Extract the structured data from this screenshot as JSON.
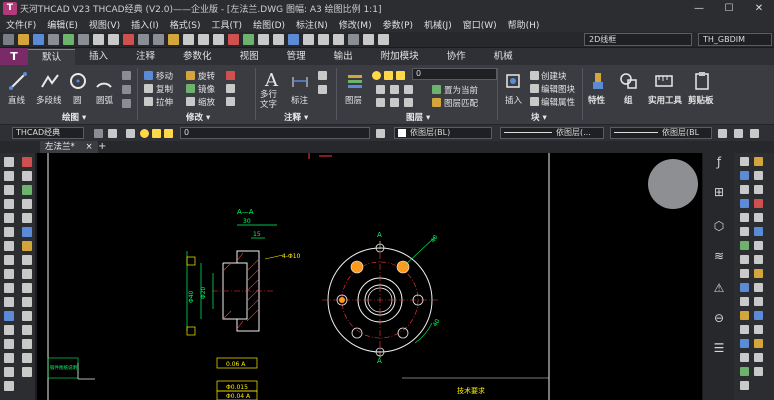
{
  "window": {
    "title": "天河THCAD V23 THCAD经典 (V2.0)——企业版 - [左法兰.DWG 图幅: A3 绘图比例 1:1]",
    "logo": "T",
    "controls": [
      "—",
      "☐",
      "✕"
    ]
  },
  "menu": [
    "文件(F)",
    "编辑(E)",
    "视图(V)",
    "插入(I)",
    "格式(S)",
    "工具(T)",
    "绘图(D)",
    "标注(N)",
    "修改(M)",
    "参数(P)",
    "机械(J)",
    "窗口(W)",
    "帮助(H)"
  ],
  "quick_access": {
    "view_select": "2D线框",
    "dimstyle_select": "TH_GBDIM"
  },
  "ribbon_tabs": {
    "app_button": "T",
    "tabs": [
      "默认",
      "插入",
      "注释",
      "参数化",
      "视图",
      "管理",
      "输出",
      "附加模块",
      "协作",
      "机械"
    ],
    "active_index": 0
  },
  "ribbon": {
    "draw": {
      "line": "直线",
      "polyline": "多段线",
      "circle": "圆",
      "arc": "圆弧",
      "title": "绘图 ▾"
    },
    "modify": {
      "move": "移动",
      "rotate": "旋转",
      "copy": "复制",
      "mirror": "镜像",
      "stretch": "拉伸",
      "scale": "缩放",
      "title": "修改 ▾"
    },
    "annotation": {
      "text": "多行文字",
      "dimension": "标注",
      "title": "注释 ▾"
    },
    "layers": {
      "layer_props": "图层",
      "current_layer": "0",
      "make_current": "置为当前",
      "match_layer": "图层匹配",
      "title": "图层 ▾"
    },
    "block": {
      "insert": "插入",
      "create": "创建块",
      "edit": "编辑图块",
      "edit_attr": "编辑属性",
      "title": "块 ▾"
    },
    "properties": {
      "label": "特性"
    },
    "groups": {
      "label": "组"
    },
    "utilities": {
      "label": "实用工具"
    },
    "clipboard": {
      "label": "剪贴板"
    }
  },
  "property_bar": {
    "style": "THCAD经典",
    "layer": "0",
    "color": "依图层(BL)",
    "linetype": "依图层(...",
    "lineweight": "依图层(BL"
  },
  "document": {
    "tab": "左法兰*",
    "close": "×",
    "add": "+"
  },
  "drawing": {
    "section_label": "A—A",
    "view_label": "A",
    "dim_30": "30",
    "dim_15": "15",
    "dim_hole": "4-Φ10",
    "dim_40": "40",
    "dim_phi20": "Φ20",
    "dim_phi40": "Φ40",
    "tol_1": "0.06 A",
    "tol_2": "Φ0.015",
    "tol_3": "Φ0.04 A",
    "requirements": "技术要求",
    "title_block_text": "锻件图纸说明"
  },
  "colors": {
    "accent": "#5b8ad6",
    "app_brand": "#7a2a66",
    "canvas": "#000000",
    "cad_green": "#00ff66",
    "cad_red": "#ff3b3b",
    "cad_yellow": "#ffee00",
    "cad_cyan": "#19e6e6",
    "cad_white": "#f0f0f0"
  },
  "right_palette_icons": [
    "function-icon",
    "hierarchy-icon",
    "cube-icon",
    "layers-icon",
    "warning-icon",
    "balloon-icon",
    "sliders-icon"
  ]
}
